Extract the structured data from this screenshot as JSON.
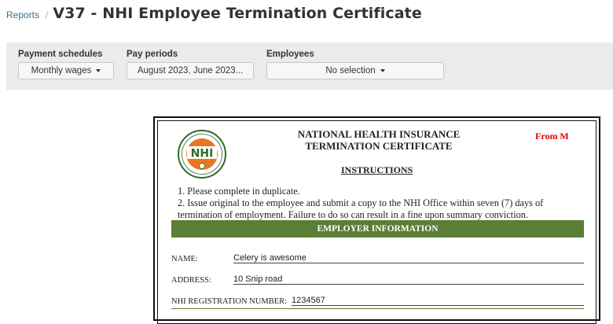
{
  "breadcrumb": {
    "link": "Reports",
    "separator": "/"
  },
  "page_title": "V37 - NHI Employee Termination Certificate",
  "filters": [
    {
      "label": "Payment schedules",
      "value": "Monthly wages"
    },
    {
      "label": "Pay periods",
      "value": "August 2023, June 2023..."
    },
    {
      "label": "Employees",
      "value": "No selection"
    }
  ],
  "certificate": {
    "title_line1": "NATIONAL HEALTH INSURANCE",
    "title_line2": "TERMINATION CERTIFICATE",
    "form_code": "From M",
    "logo_text": "NHI",
    "instructions_heading": "INSTRUCTIONS",
    "instruction_1": "1. Please complete in duplicate.",
    "instruction_2": "2. Issue original to the employee and submit a copy to the NHI Office within seven (7) days of termination of employment. Failure to do so can result in a fine upon summary conviction.",
    "section_title": "EMPLOYER INFORMATION",
    "name_label": "NAME:",
    "name_value": "Celery is awesome",
    "address_label": "ADDRESS:",
    "address_value": "10 Snip road",
    "reg_label": "NHI REGISTRATION NUMBER:",
    "reg_value": "1234567"
  },
  "colors": {
    "link": "#3a6f8f",
    "section_bar": "#5a7e35",
    "form_code": "#dd0000",
    "logo_orange": "#e87722",
    "logo_green": "#2e6b2e"
  }
}
